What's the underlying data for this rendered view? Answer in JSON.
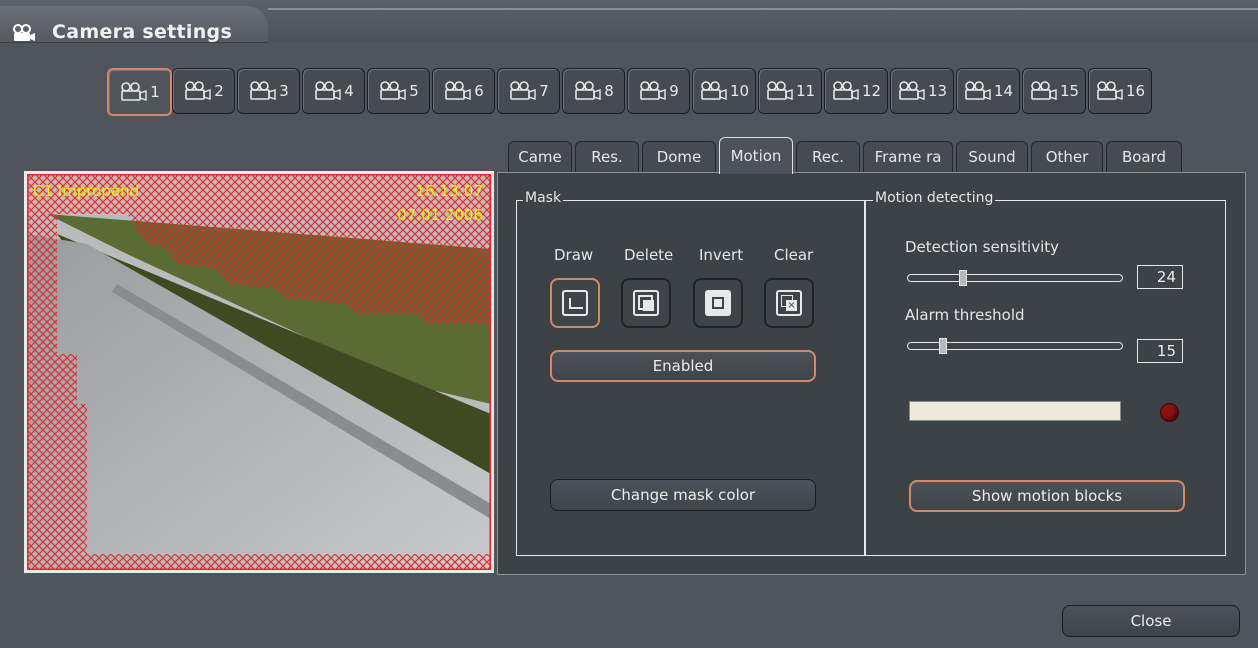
{
  "window": {
    "title": "Camera settings",
    "title_icon": "camera-icon"
  },
  "cameras": [
    {
      "label": "1",
      "active": true
    },
    {
      "label": "2"
    },
    {
      "label": "3"
    },
    {
      "label": "4"
    },
    {
      "label": "5"
    },
    {
      "label": "6"
    },
    {
      "label": "7"
    },
    {
      "label": "8"
    },
    {
      "label": "9"
    },
    {
      "label": "10"
    },
    {
      "label": "11"
    },
    {
      "label": "12"
    },
    {
      "label": "13"
    },
    {
      "label": "14"
    },
    {
      "label": "15"
    },
    {
      "label": "16"
    }
  ],
  "tabs": [
    {
      "label": "Came"
    },
    {
      "label": "Res."
    },
    {
      "label": "Dome"
    },
    {
      "label": "Motion",
      "active": true
    },
    {
      "label": "Rec."
    },
    {
      "label": "Frame ra"
    },
    {
      "label": "Sound"
    },
    {
      "label": "Other"
    },
    {
      "label": "Board"
    }
  ],
  "preview": {
    "camera_name": "C1 Impropand",
    "time": "16:13:07",
    "date": "07.01.2006",
    "overlay_color": "#e8232a"
  },
  "mask": {
    "group_label": "Mask",
    "tools": [
      {
        "label": "Draw",
        "icon": "draw-mask-icon",
        "active": true
      },
      {
        "label": "Delete",
        "icon": "delete-mask-icon"
      },
      {
        "label": "Invert",
        "icon": "invert-mask-icon"
      },
      {
        "label": "Clear",
        "icon": "clear-mask-icon"
      }
    ],
    "enabled_label": "Enabled",
    "change_color_label": "Change mask color"
  },
  "motion": {
    "group_label": "Motion detecting",
    "sensitivity_label": "Detection sensitivity",
    "sensitivity_value": "24",
    "sensitivity_fraction": 0.24,
    "threshold_label": "Alarm threshold",
    "threshold_value": "15",
    "threshold_fraction": 0.15,
    "motion_level_fraction": 0,
    "alarm_led_color": "#8a1214",
    "show_blocks_label": "Show motion blocks"
  },
  "footer": {
    "close_label": "Close"
  },
  "colors": {
    "accent": "#d5876a",
    "background": "#50555c",
    "panel": "#3d4247"
  }
}
